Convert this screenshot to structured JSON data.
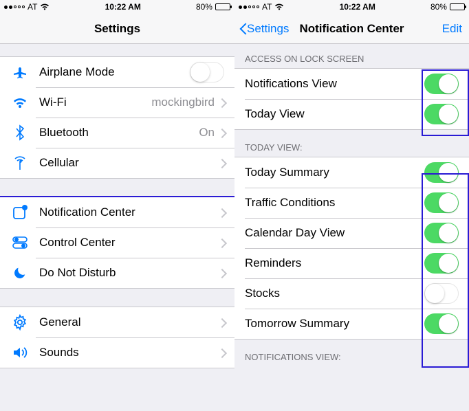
{
  "status": {
    "carrier": "AT",
    "time": "10:22 AM",
    "battery_pct": "80%"
  },
  "left": {
    "title": "Settings",
    "rows": {
      "airplane": "Airplane Mode",
      "wifi": "Wi-Fi",
      "wifi_value": "mockingbird",
      "bluetooth": "Bluetooth",
      "bluetooth_value": "On",
      "cellular": "Cellular",
      "notification_center": "Notification Center",
      "control_center": "Control Center",
      "dnd": "Do Not Disturb",
      "general": "General",
      "sounds": "Sounds"
    }
  },
  "right": {
    "back": "Settings",
    "title": "Notification Center",
    "edit": "Edit",
    "section_access": "ACCESS ON LOCK SCREEN",
    "section_today": "TODAY VIEW:",
    "section_notif": "NOTIFICATIONS VIEW:",
    "rows": {
      "notifications_view": "Notifications View",
      "today_view": "Today View",
      "today_summary": "Today Summary",
      "traffic": "Traffic Conditions",
      "calendar": "Calendar Day View",
      "reminders": "Reminders",
      "stocks": "Stocks",
      "tomorrow": "Tomorrow Summary"
    },
    "switches": {
      "notifications_view": true,
      "today_view": true,
      "today_summary": true,
      "traffic": true,
      "calendar": true,
      "reminders": true,
      "stocks": false,
      "tomorrow": true
    }
  }
}
